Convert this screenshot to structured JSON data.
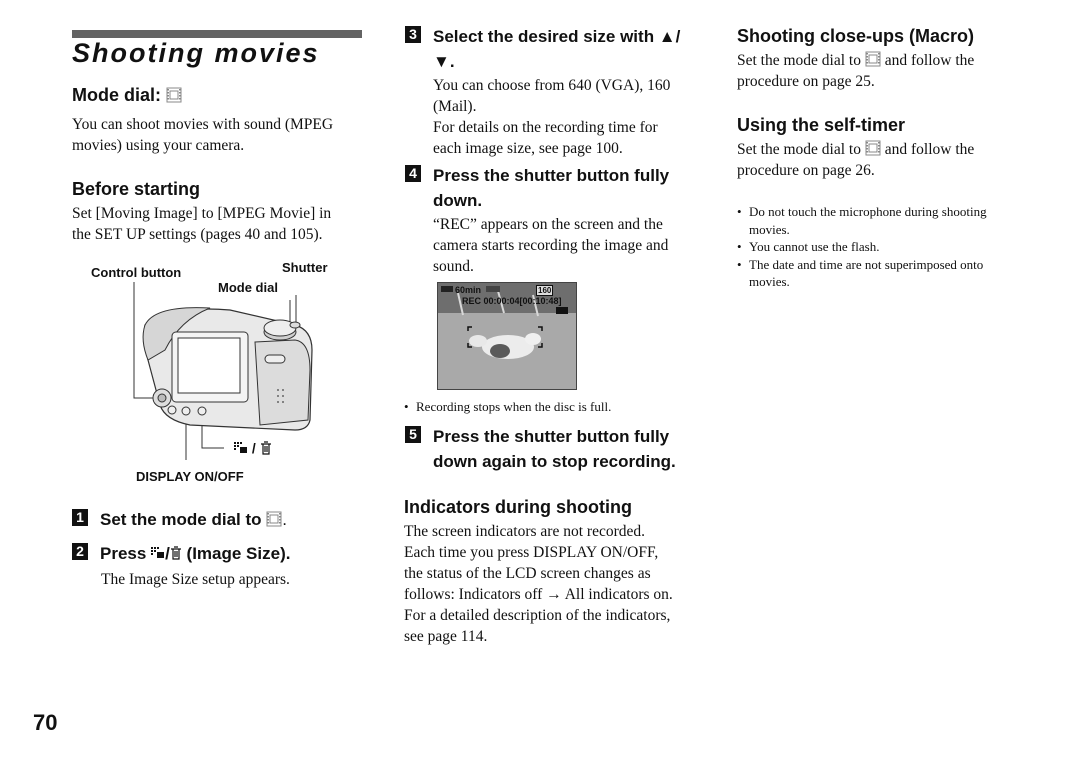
{
  "page": {
    "number": "70",
    "title": "Shooting movies"
  },
  "left_column": {
    "mode_dial_heading": "Mode dial:",
    "mode_dial_icon": "movie-mode-icon",
    "intro": [
      "You can shoot movies with sound (MPEG",
      "movies) using your camera."
    ],
    "before_starting_heading": "Before starting",
    "before_starting_text": [
      "Set [Moving Image] to [MPEG Movie] in",
      "the SET UP settings (pages 40 and 105)."
    ],
    "figure_labels": {
      "control_button": "Control button",
      "shutter": "Shutter",
      "mode_dial": "Mode dial",
      "image_size_delete": "/",
      "display": "DISPLAY ON/OFF"
    },
    "steps": [
      {
        "num": "1",
        "text_before": "Set the mode dial to",
        "text_after": "."
      },
      {
        "num": "2",
        "text_before": "Press",
        "text_after": "(Image Size).",
        "note": "The Image Size setup appears."
      }
    ]
  },
  "middle_column": {
    "steps": [
      {
        "num": "3",
        "lines": [
          "Select the desired size with ▲/",
          "▼."
        ],
        "notes": [
          "You can choose from 640 (VGA), 160",
          "(Mail).",
          "For details on the recording time for",
          "each image size, see page 100."
        ]
      },
      {
        "num": "4",
        "lines": [
          "Press the shutter button fully",
          "down."
        ],
        "notes": [
          "“REC” appears on the screen and the",
          "camera starts recording the image and",
          "sound."
        ]
      },
      {
        "num": "5",
        "lines": [
          "Press the shutter button fully",
          "down again to stop recording."
        ]
      }
    ],
    "lcd": {
      "battery": "60min",
      "rec_line": "REC 00:00:04[00:10:48]",
      "size_badge": "160"
    },
    "bullet": "Recording stops when the disc is full.",
    "indicators_heading": "Indicators during shooting",
    "indicators_text": [
      "The screen indicators are not recorded.",
      "Each time you press DISPLAY ON/OFF,",
      "the status of the LCD screen changes as",
      "follows: Indicators off → All indicators on.",
      "For a detailed description of the indicators,",
      "see page 114."
    ]
  },
  "right_column": {
    "macro_heading": "Shooting close-ups (Macro)",
    "macro_text_before": "Set the mode dial to",
    "macro_text_after": "and follow the",
    "macro_text_line2": "procedure on page 25.",
    "timer_heading": "Using the self-timer",
    "timer_text_before": "Set the mode dial to",
    "timer_text_after": "and follow the",
    "timer_text_line2": "procedure on page 26.",
    "bullets": [
      "Do not touch the microphone during shooting movies.",
      "You cannot use the flash.",
      "The date and time are not superimposed onto movies."
    ]
  }
}
